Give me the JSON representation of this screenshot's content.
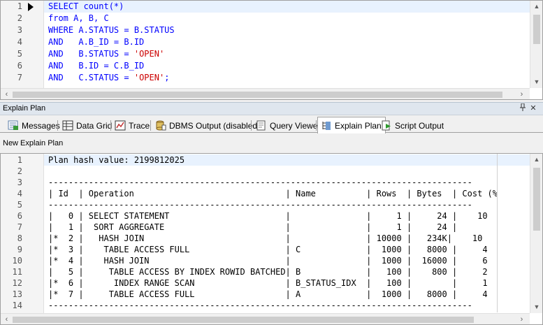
{
  "editor": {
    "lines": [
      {
        "num": "1",
        "tokens": [
          {
            "t": "SELECT ",
            "c": "kw"
          },
          {
            "t": "count",
            "c": "fn"
          },
          {
            "t": "(*)",
            "c": "kw"
          }
        ]
      },
      {
        "num": "2",
        "tokens": [
          {
            "t": "from ",
            "c": "kw"
          },
          {
            "t": "A, B, C",
            "c": "kw"
          }
        ]
      },
      {
        "num": "3",
        "tokens": [
          {
            "t": "WHERE ",
            "c": "kw"
          },
          {
            "t": "A.STATUS = B.STATUS",
            "c": "kw"
          }
        ]
      },
      {
        "num": "4",
        "tokens": [
          {
            "t": "AND",
            "c": "kw"
          },
          {
            "t": "   A.B_ID = B.ID",
            "c": "kw"
          }
        ]
      },
      {
        "num": "5",
        "tokens": [
          {
            "t": "AND",
            "c": "kw"
          },
          {
            "t": "   B.STATUS = ",
            "c": "kw"
          },
          {
            "t": "'OPEN'",
            "c": "str"
          }
        ]
      },
      {
        "num": "6",
        "tokens": [
          {
            "t": "AND",
            "c": "kw"
          },
          {
            "t": "   B.ID = C.B_ID",
            "c": "kw"
          }
        ]
      },
      {
        "num": "7",
        "tokens": [
          {
            "t": "AND",
            "c": "kw"
          },
          {
            "t": "   C.STATUS = ",
            "c": "kw"
          },
          {
            "t": "'OPEN'",
            "c": "str"
          },
          {
            "t": ";",
            "c": "kw"
          }
        ]
      }
    ]
  },
  "panel": {
    "title": "Explain Plan",
    "pin_icon": "pin-icon",
    "close_icon": "close-icon"
  },
  "tabs": [
    {
      "label": "Messages",
      "icon": "messages-icon",
      "active": false
    },
    {
      "label": "Data Grid",
      "icon": "data-grid-icon",
      "active": false
    },
    {
      "label": "Trace",
      "icon": "trace-icon",
      "active": false
    },
    {
      "label": "DBMS Output (disabled)",
      "icon": "dbms-output-icon",
      "active": false
    },
    {
      "label": "Query Viewer",
      "icon": "query-viewer-icon",
      "active": false
    },
    {
      "label": "Explain Plan",
      "icon": "explain-plan-icon",
      "active": true
    },
    {
      "label": "Script Output",
      "icon": "script-output-icon",
      "active": false
    }
  ],
  "plan_header": "New Explain Plan",
  "plan": {
    "lines": [
      {
        "num": "1",
        "text": "Plan hash value: 2199812025"
      },
      {
        "num": "2",
        "text": ""
      },
      {
        "num": "3",
        "text": "------------------------------------------------------------------------------------"
      },
      {
        "num": "4",
        "text": "| Id  | Operation                              | Name          | Rows  | Bytes  | Cost (%"
      },
      {
        "num": "5",
        "text": "------------------------------------------------------------------------------------"
      },
      {
        "num": "6",
        "text": "|   0 | SELECT STATEMENT                       |               |     1 |     24 |    10"
      },
      {
        "num": "7",
        "text": "|   1 |  SORT AGGREGATE                        |               |     1 |     24 |"
      },
      {
        "num": "8",
        "text": "|*  2 |   HASH JOIN                            |               | 10000 |   234K|    10"
      },
      {
        "num": "9",
        "text": "|*  3 |    TABLE ACCESS FULL                   | C             |  1000 |   8000 |     4"
      },
      {
        "num": "10",
        "text": "|*  4 |    HASH JOIN                           |               |  1000 |  16000 |     6"
      },
      {
        "num": "11",
        "text": "|   5 |     TABLE ACCESS BY INDEX ROWID BATCHED| B             |   100 |    800 |     2"
      },
      {
        "num": "12",
        "text": "|*  6 |      INDEX RANGE SCAN                  | B_STATUS_IDX  |   100 |        |     1"
      },
      {
        "num": "13",
        "text": "|*  7 |     TABLE ACCESS FULL                  | A             |  1000 |   8000 |     4"
      },
      {
        "num": "14",
        "text": "------------------------------------------------------------------------------------"
      }
    ]
  },
  "colors": {
    "keyword": "#0000ff",
    "string": "#cc0000",
    "current_line": "#e8f2fe"
  }
}
